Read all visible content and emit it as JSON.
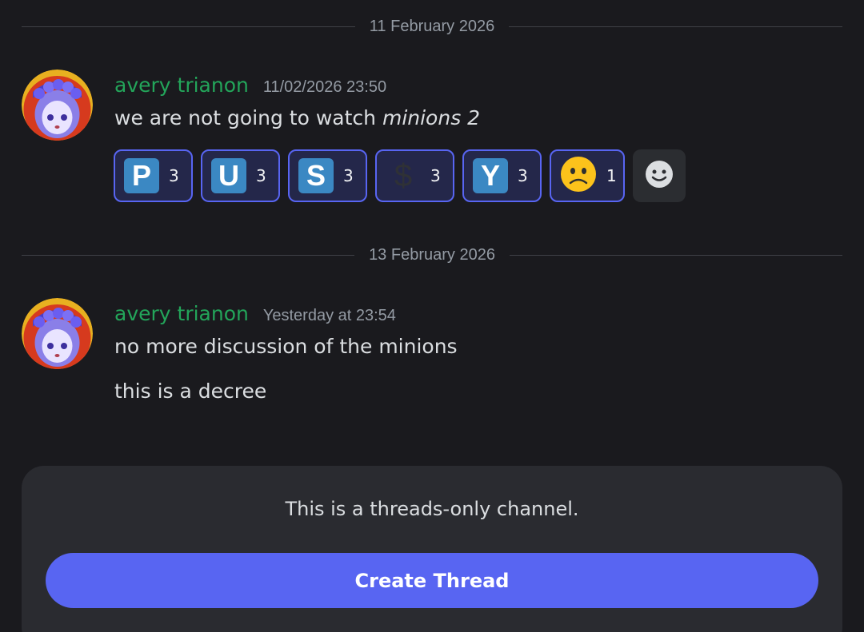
{
  "dividers": {
    "first": "11 February 2026",
    "second": "13 February 2026"
  },
  "messages": [
    {
      "username": "avery trianon",
      "timestamp": "11/02/2026 23:50",
      "text_prefix": "we are not going to watch ",
      "text_italic": "minions 2",
      "reactions": [
        {
          "emoji": "P",
          "icon": "regional-indicator-p-icon",
          "count": "3"
        },
        {
          "emoji": "U",
          "icon": "regional-indicator-u-icon",
          "count": "3"
        },
        {
          "emoji": "S",
          "icon": "regional-indicator-s-icon",
          "count": "3"
        },
        {
          "emoji": "$",
          "icon": "heavy-dollar-sign-icon",
          "count": "3"
        },
        {
          "emoji": "Y",
          "icon": "regional-indicator-y-icon",
          "count": "3"
        },
        {
          "emoji": "🙁",
          "icon": "slightly-frowning-face-icon",
          "count": "1"
        }
      ],
      "add_reaction_icon": "add-reaction-icon"
    },
    {
      "username": "avery trianon",
      "timestamp": "Yesterday at 23:54",
      "lines": [
        "no more discussion of the minions",
        "this is a decree"
      ]
    }
  ],
  "threads_panel": {
    "notice": "This is a threads-only channel.",
    "button_label": "Create Thread"
  },
  "colors": {
    "background": "#1a1a1e",
    "username": "#23a55a",
    "accent": "#5865f2",
    "reaction_tile": "#3b88c3"
  }
}
